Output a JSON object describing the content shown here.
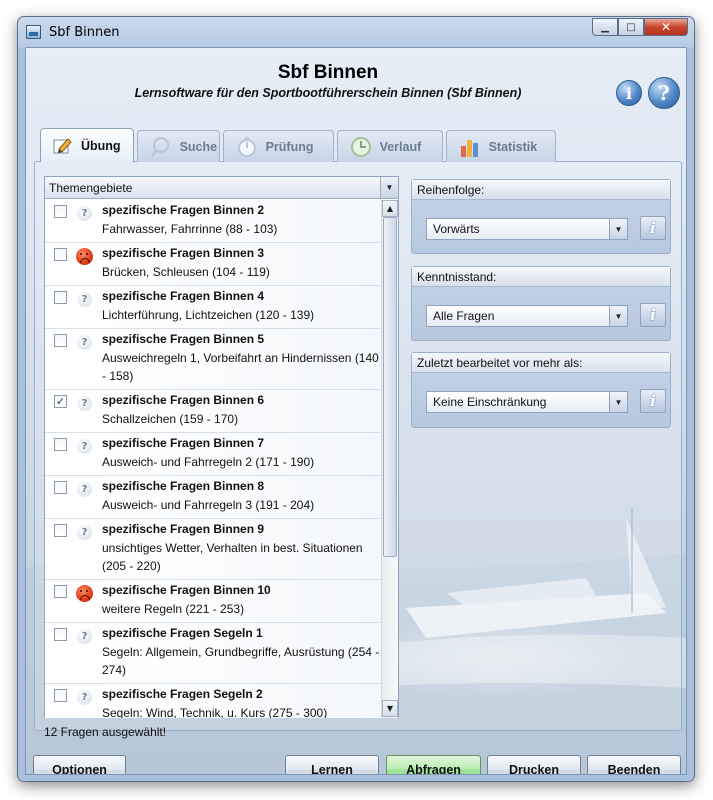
{
  "window": {
    "title": "Sbf Binnen",
    "controls": {
      "minimize": "▁",
      "maximize": "□",
      "close": "✕"
    }
  },
  "header": {
    "title": "Sbf Binnen",
    "subtitle": "Lernsoftware für den Sportbootführerschein Binnen (Sbf Binnen)",
    "info_glyph": "i",
    "help_glyph": "?"
  },
  "tabs": [
    {
      "label": "Übung",
      "icon": "pencil-icon",
      "active": true
    },
    {
      "label": "Suche",
      "icon": "magnifier-icon",
      "active": false
    },
    {
      "label": "Prüfung",
      "icon": "stopwatch-icon",
      "active": false
    },
    {
      "label": "Verlauf",
      "icon": "history-clock-icon",
      "active": false
    },
    {
      "label": "Statistik",
      "icon": "bar-chart-icon",
      "active": false
    }
  ],
  "topics": {
    "header": "Themengebiete",
    "items": [
      {
        "title": "spezifische Fragen Binnen 2",
        "desc": "Fahrwasser, Fahrrinne (88 - 103)",
        "checked": false,
        "status": "question"
      },
      {
        "title": "spezifische Fragen Binnen 3",
        "desc": "Brücken, Schleusen (104 - 119)",
        "checked": false,
        "status": "sad"
      },
      {
        "title": "spezifische Fragen Binnen 4",
        "desc": "Lichterführung, Lichtzeichen (120 - 139)",
        "checked": false,
        "status": "question"
      },
      {
        "title": "spezifische Fragen Binnen 5",
        "desc": "Ausweichregeln 1, Vorbeifahrt an Hindernissen (140 - 158)",
        "checked": false,
        "status": "question"
      },
      {
        "title": "spezifische Fragen Binnen 6",
        "desc": "Schallzeichen (159 - 170)",
        "checked": true,
        "status": "question"
      },
      {
        "title": "spezifische Fragen Binnen 7",
        "desc": "Ausweich- und Fahrregeln 2 (171 - 190)",
        "checked": false,
        "status": "question"
      },
      {
        "title": "spezifische Fragen Binnen 8",
        "desc": "Ausweich- und Fahrregeln 3 (191 - 204)",
        "checked": false,
        "status": "question"
      },
      {
        "title": "spezifische Fragen Binnen 9",
        "desc": "unsichtiges Wetter, Verhalten in best. Situationen (205 - 220)",
        "checked": false,
        "status": "question"
      },
      {
        "title": "spezifische Fragen Binnen 10",
        "desc": "weitere Regeln (221 - 253)",
        "checked": false,
        "status": "sad"
      },
      {
        "title": "spezifische Fragen Segeln 1",
        "desc": "Segeln: Allgemein, Grundbegriffe, Ausrüstung (254 - 274)",
        "checked": false,
        "status": "question"
      },
      {
        "title": "spezifische Fragen Segeln 2",
        "desc": "Segeln: Wind, Technik, u. Kurs (275 - 300)",
        "checked": false,
        "status": "question"
      }
    ],
    "checkmark": "✓",
    "question_glyph": "?"
  },
  "status_text": "12 Fragen ausgewählt!",
  "settings": {
    "order": {
      "label": "Reihenfolge:",
      "value": "Vorwärts"
    },
    "knowledge": {
      "label": "Kenntnisstand:",
      "value": "Alle Fragen"
    },
    "last_edited": {
      "label": "Zuletzt bearbeitet vor mehr als:",
      "value": "Keine Einschränkung"
    },
    "info_glyph": "i",
    "dropdown_glyph": "▼"
  },
  "buttons": {
    "options": "Optionen",
    "learn": "Lernen",
    "quiz": "Abfragen",
    "print": "Drucken",
    "quit": "Beenden"
  },
  "scroll": {
    "up": "▲",
    "down": "▼"
  }
}
